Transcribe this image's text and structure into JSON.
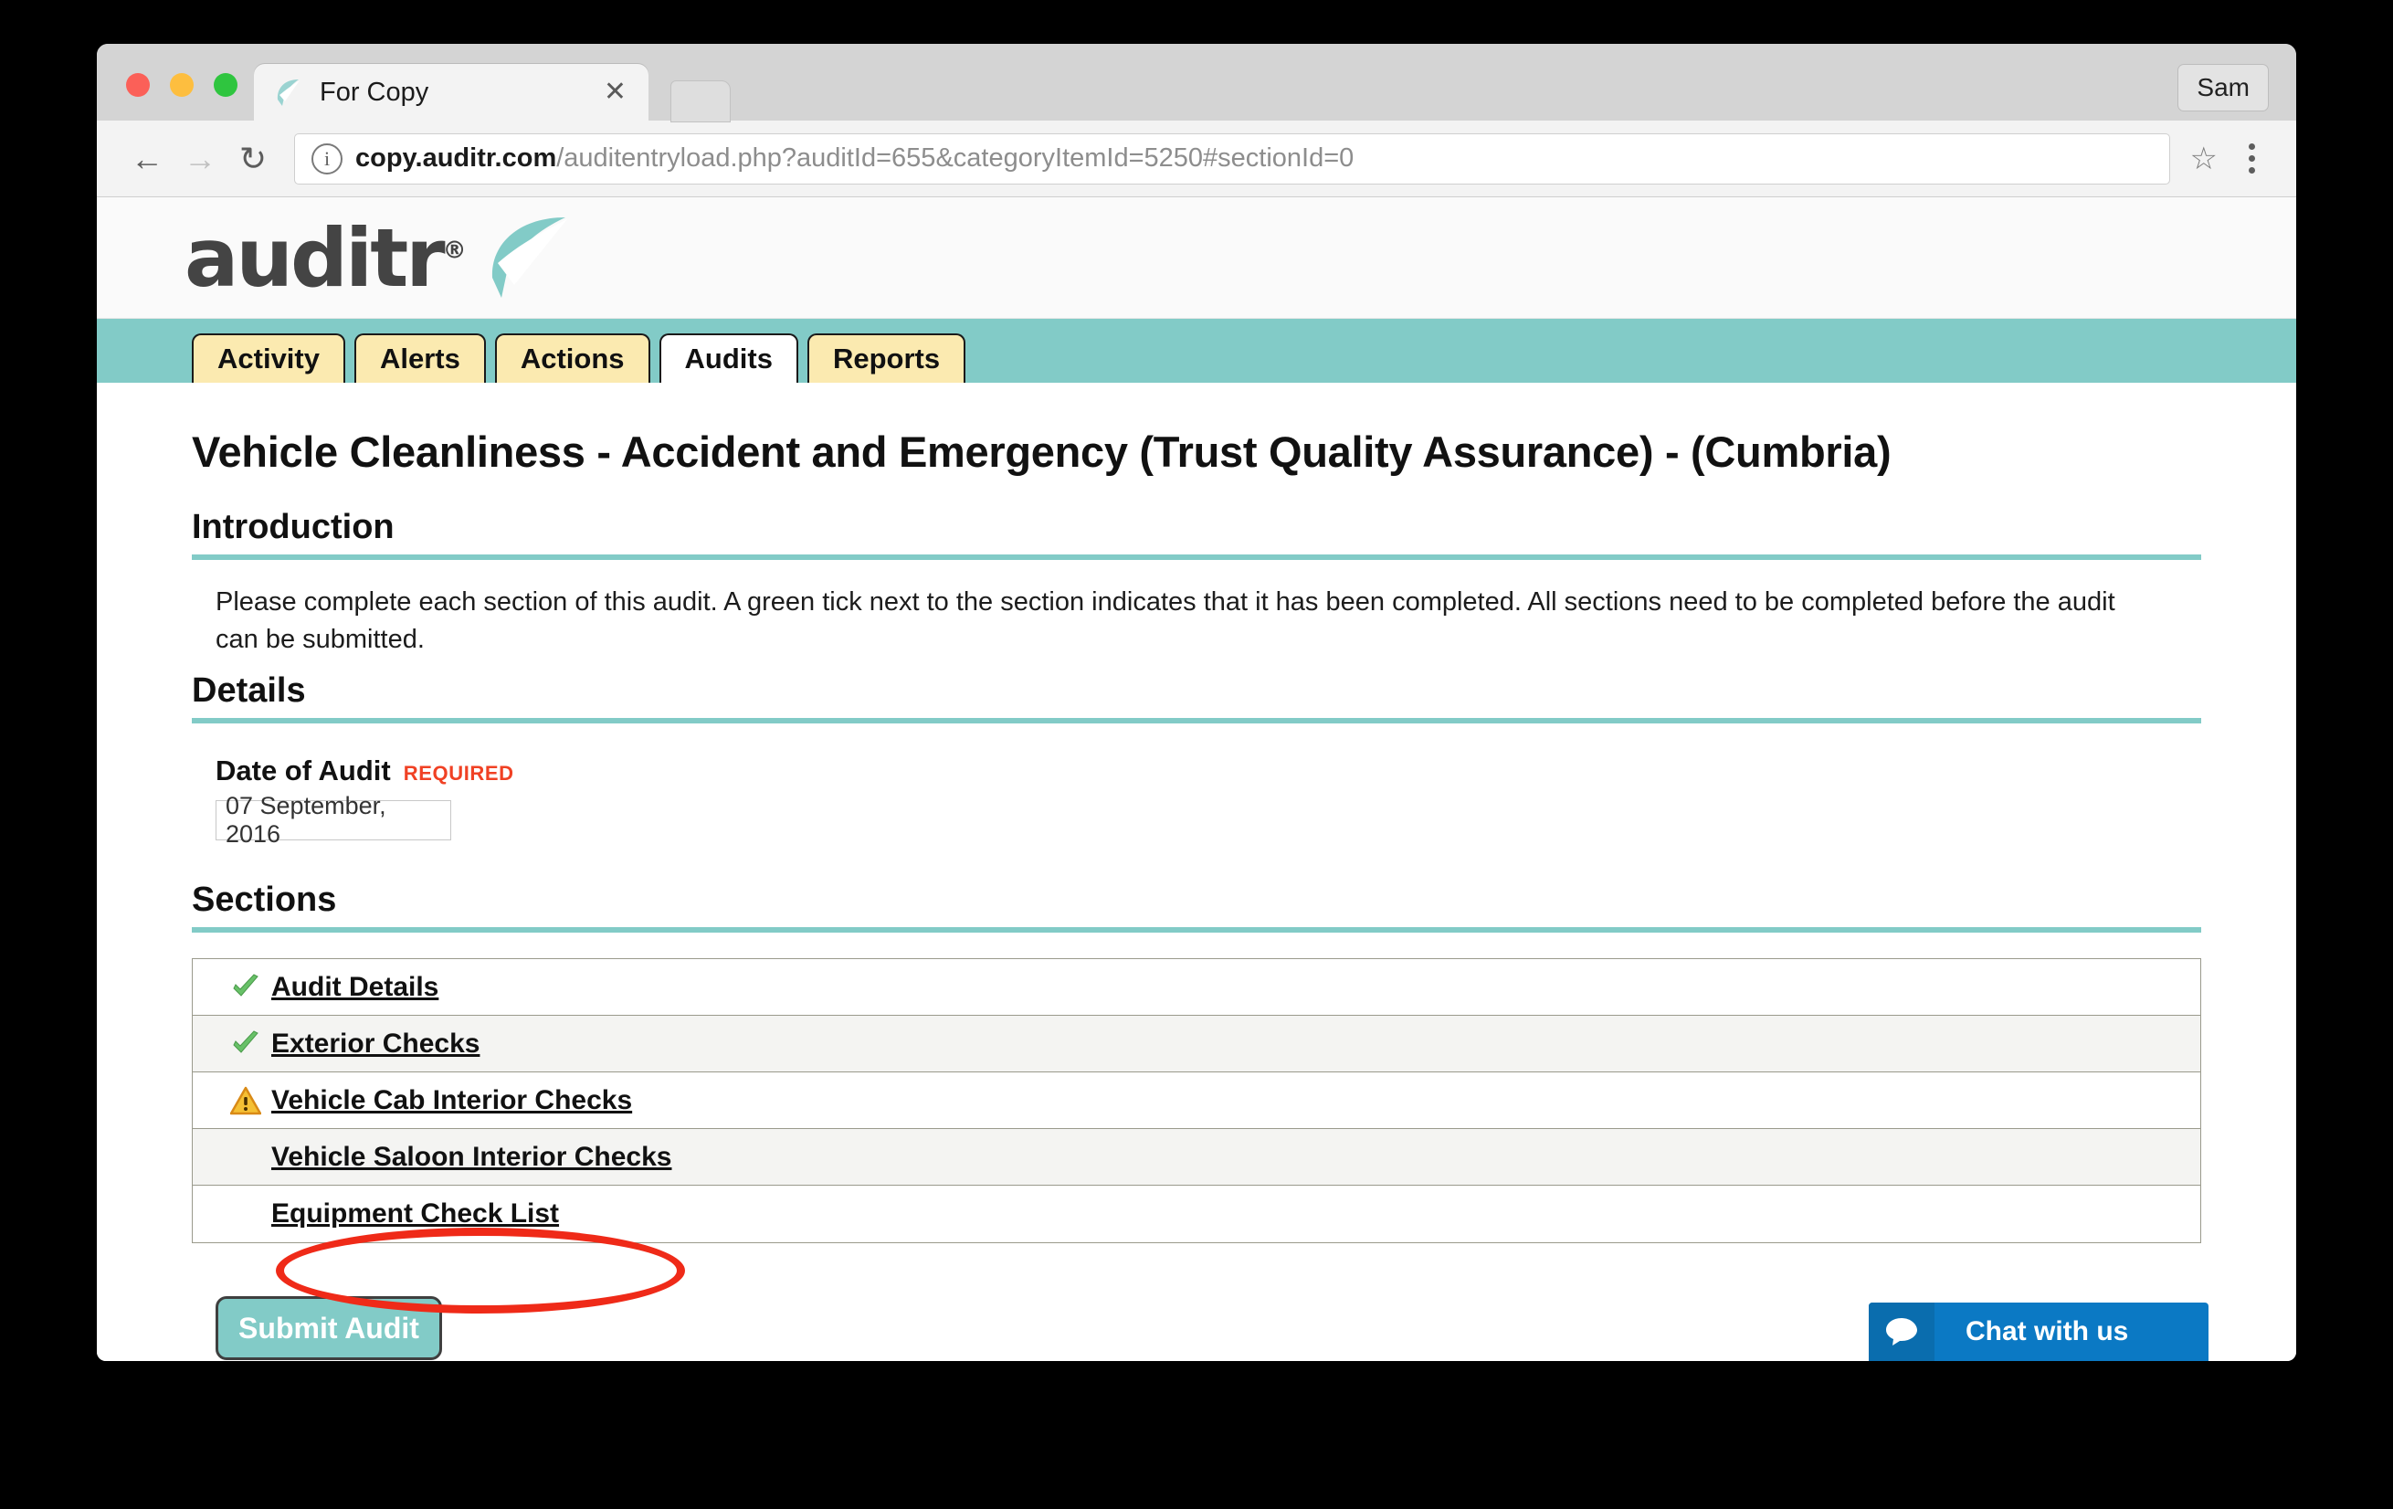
{
  "browser": {
    "tab": {
      "title": "For Copy",
      "favicon": "leaf-check-icon",
      "close": "✕"
    },
    "profile_label": "Sam",
    "nav": {
      "back": "←",
      "forward": "→",
      "reload": "↻"
    },
    "omnibox": {
      "security_icon": "info-icon",
      "url_domain": "copy.auditr.com",
      "url_path": "/auditentryload.php?auditId=655&categoryItemId=5250#sectionId=0",
      "bookmark_icon": "star-icon",
      "menu_icon": "kebab-menu-icon"
    }
  },
  "site": {
    "logo_text": "auditr",
    "logo_registered": "®",
    "nav_tabs": [
      {
        "label": "Activity",
        "active": false
      },
      {
        "label": "Alerts",
        "active": false
      },
      {
        "label": "Actions",
        "active": false
      },
      {
        "label": "Audits",
        "active": true
      },
      {
        "label": "Reports",
        "active": false
      }
    ],
    "accent_teal": "#82cbc7",
    "tab_cream": "#fbeab0"
  },
  "main": {
    "page_title": "Vehicle Cleanliness - Accident and Emergency (Trust Quality Assurance) - (Cumbria)",
    "introduction": {
      "heading": "Introduction",
      "text": "Please complete each section of this audit. A green tick next to the section indicates that it has been completed. All sections need to be completed before the audit can be submitted."
    },
    "details": {
      "heading": "Details",
      "date_label": "Date of Audit",
      "required_badge": "REQUIRED",
      "date_value": "07 September, 2016"
    },
    "sections": {
      "heading": "Sections",
      "items": [
        {
          "label": "Audit Details",
          "status": "complete-check-icon"
        },
        {
          "label": "Exterior Checks",
          "status": "complete-check-icon"
        },
        {
          "label": "Vehicle Cab Interior Checks",
          "status": "warning-triangle-icon"
        },
        {
          "label": "Vehicle Saloon Interior Checks",
          "status": "none"
        },
        {
          "label": "Equipment Check List",
          "status": "none"
        }
      ]
    },
    "submit_label": "Submit Audit"
  },
  "chat_widget": {
    "label": "Chat with us",
    "icon": "speech-bubble-icon",
    "color": "#0b79c4"
  },
  "annotation": {
    "type": "red-ellipse-highlight",
    "target": "Vehicle Cab Interior Checks",
    "color": "#ef2a18"
  }
}
